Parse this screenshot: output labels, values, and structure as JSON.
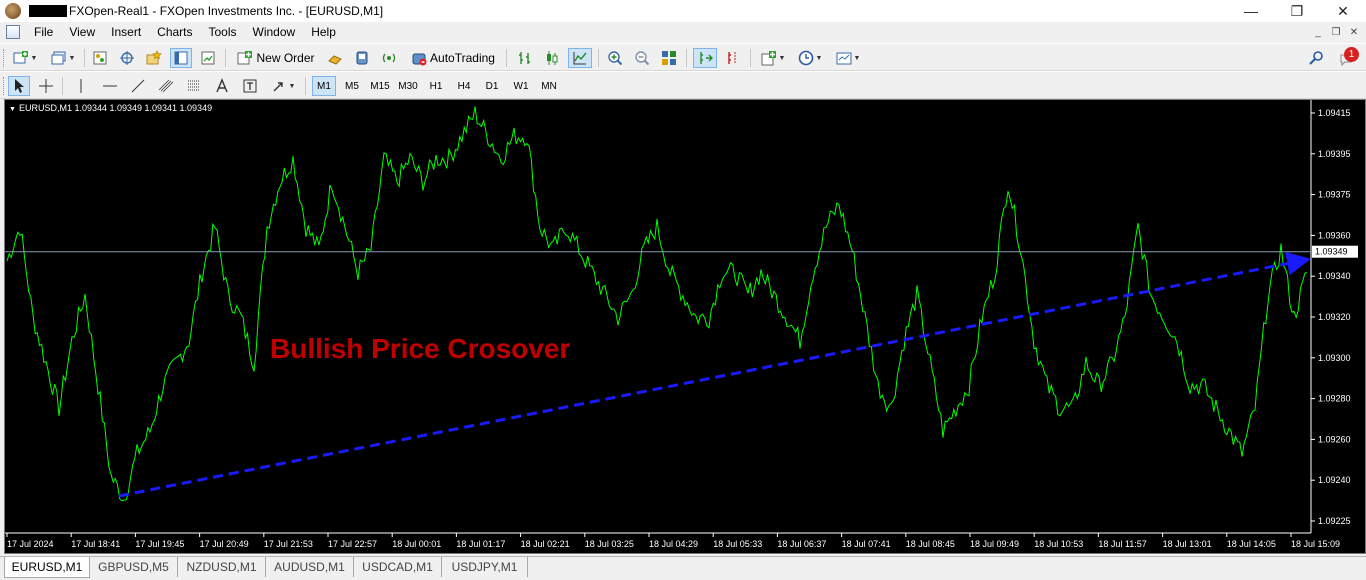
{
  "window": {
    "title": "FXOpen-Real1 - FXOpen Investments Inc. - [EURUSD,M1]",
    "minimize_glyph": "—",
    "maximize_glyph": "❐",
    "close_glyph": "✕"
  },
  "menu": {
    "items": [
      "File",
      "View",
      "Insert",
      "Charts",
      "Tools",
      "Window",
      "Help"
    ],
    "mdi_minimize": "_",
    "mdi_restore": "❐",
    "mdi_close": "✕"
  },
  "toolbar": {
    "new_order_label": "New Order",
    "autotrading_label": "AutoTrading",
    "notification_count": "1"
  },
  "timeframes": [
    "M1",
    "M5",
    "M15",
    "M30",
    "H1",
    "H4",
    "D1",
    "W1",
    "MN"
  ],
  "active_timeframe": "M1",
  "chart": {
    "header": "EURUSD,M1  1.09344 1.09349 1.09341 1.09349",
    "header_symbol": "▼",
    "annotation": "Bullish Price Crosover",
    "current_price_label": "1.09349",
    "colors": {
      "background": "#000000",
      "line": "#00ff00",
      "bid_line": "#8aa0b8",
      "trend_arrow": "#1a1aff",
      "annotation": "#c00000",
      "axis_text": "#ffffff"
    }
  },
  "chart_data": {
    "type": "line",
    "y_ticks": [
      "1.09415",
      "1.09395",
      "1.09375",
      "1.09360",
      "1.09340",
      "1.09320",
      "1.09300",
      "1.09280",
      "1.09260",
      "1.09240",
      "1.09225"
    ],
    "x_ticks": [
      "17 Jul 2024",
      "17 Jul 18:41",
      "17 Jul 19:45",
      "17 Jul 20:49",
      "17 Jul 21:53",
      "17 Jul 22:57",
      "18 Jul 00:01",
      "18 Jul 01:17",
      "18 Jul 02:21",
      "18 Jul 03:25",
      "18 Jul 04:29",
      "18 Jul 05:33",
      "18 Jul 06:37",
      "18 Jul 07:41",
      "18 Jul 08:45",
      "18 Jul 09:49",
      "18 Jul 10:53",
      "18 Jul 11:57",
      "18 Jul 13:01",
      "18 Jul 14:05",
      "18 Jul 15:09"
    ],
    "ylim": [
      1.09225,
      1.09415
    ],
    "current_price": 1.09349,
    "series": [
      {
        "values": [
          1.09345,
          1.0936,
          1.0932,
          1.093,
          1.0928,
          1.0931,
          1.0933,
          1.0929,
          1.0925,
          1.0924,
          1.0926,
          1.0927,
          1.0929,
          1.093,
          1.0931,
          1.0934,
          1.0936,
          1.0933,
          1.0932,
          1.093,
          1.0936,
          1.0938,
          1.0939,
          1.0936,
          1.0935,
          1.0938,
          1.0936,
          1.0934,
          1.0935,
          1.0939,
          1.0938,
          1.0939,
          1.0938,
          1.0939,
          1.0939,
          1.094,
          1.0941,
          1.094,
          1.0939,
          1.094,
          1.094,
          1.0936,
          1.0935,
          1.0936,
          1.0935,
          1.0934,
          1.0933,
          1.0932,
          1.0933,
          1.0935,
          1.0936,
          1.0934,
          1.0933,
          1.0932,
          1.0932,
          1.0934,
          1.0934,
          1.0933,
          1.0934,
          1.0933,
          1.0932,
          1.0931,
          1.0934,
          1.0936,
          1.0937,
          1.0935,
          1.0932,
          1.0929,
          1.0928,
          1.0931,
          1.0933,
          1.093,
          1.0927,
          1.0928,
          1.0929,
          1.0932,
          1.0934,
          1.0938,
          1.0935,
          1.0931,
          1.0929,
          1.0928,
          1.0928,
          1.093,
          1.0929,
          1.093,
          1.0932,
          1.0936,
          1.0933,
          1.0932,
          1.0931,
          1.0929,
          1.0929,
          1.0928,
          1.0927,
          1.0926,
          1.0928,
          1.0933,
          1.0935,
          1.0932,
          1.0934
        ]
      }
    ],
    "annotations": [
      "Bullish Price Crosover"
    ]
  },
  "tabs": [
    "EURUSD,M1",
    "GBPUSD,M5",
    "NZDUSD,M1",
    "AUDUSD,M1",
    "USDCAD,M1",
    "USDJPY,M1"
  ],
  "active_tab": "EURUSD,M1"
}
